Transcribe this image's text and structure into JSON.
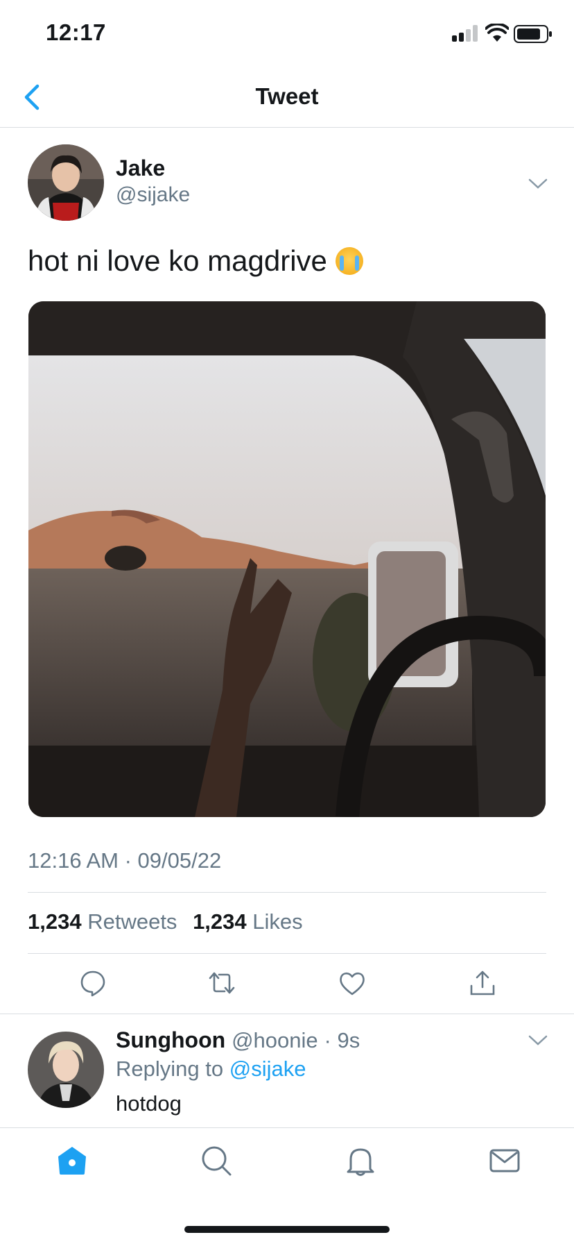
{
  "status_bar": {
    "time": "12:17"
  },
  "nav": {
    "title": "Tweet"
  },
  "tweet": {
    "author_name": "Jake",
    "author_handle": "@sijake",
    "text": "hot ni love ko magdrive",
    "emoji_icon": "loudly-crying-face-icon",
    "timestamp": "12:16 AM · 09/05/22",
    "retweets_count": "1,234",
    "retweets_label": "Retweets",
    "likes_count": "1,234",
    "likes_label": "Likes"
  },
  "reply": {
    "author_name": "Sunghoon",
    "author_handle": "@hoonie",
    "time": "· 9s",
    "replying_label": "Replying to",
    "replying_mention": "@sijake",
    "text": "hotdog"
  },
  "actions": [
    "reply-icon",
    "retweet-icon",
    "like-icon",
    "share-icon"
  ],
  "tab_bar": [
    "home-icon",
    "search-icon",
    "notifications-icon",
    "messages-icon"
  ],
  "colors": {
    "accent": "#1da1f2",
    "text": "#14171a",
    "secondary": "#657786",
    "divider": "#d9dde1"
  }
}
